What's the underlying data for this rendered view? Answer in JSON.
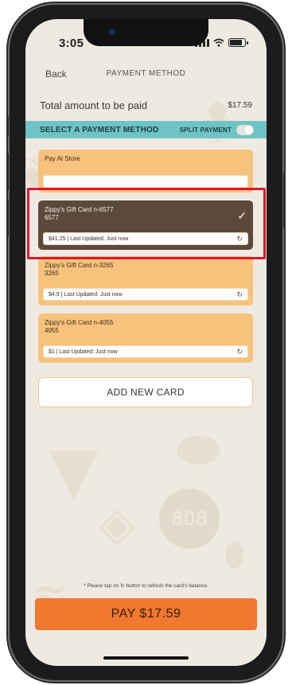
{
  "status_bar": {
    "time": "3:05"
  },
  "navbar": {
    "back_label": "Back",
    "title": "PAYMENT METHOD"
  },
  "total": {
    "label": "Total amount to be paid",
    "value": "$17.59"
  },
  "select_section": {
    "label": "SELECT A PAYMENT METHOD",
    "split_label": "SPLIT PAYMENT",
    "split_enabled": false
  },
  "cards": [
    {
      "title": "Pay At Store",
      "subtitle": "",
      "detail": "",
      "selected": false
    },
    {
      "title": "Zippy's Gift Card n-6577",
      "subtitle": "6577",
      "detail": "$41.25 | Last Updated: Just now",
      "selected": true
    },
    {
      "title": "Zippy's Gift Card n-3265",
      "subtitle": "3265",
      "detail": "$4.9 | Last Updated: Just now",
      "selected": false
    },
    {
      "title": "Zippy's Gift Card n-4055",
      "subtitle": "4055",
      "detail": "$1 | Last Updated: Just now",
      "selected": false
    }
  ],
  "add_card_label": "ADD NEW CARD",
  "note_parts": {
    "before": "* Please tap on",
    "after": "button to refresh the card's balance."
  },
  "pay_button_label": "PAY $17.59",
  "background_text": {
    "number": "808"
  },
  "colors": {
    "accent_orange": "#f0782f",
    "card_orange": "#f7c27c",
    "selected_card": "#5b4a3b",
    "section_teal": "#6ec3c4",
    "highlight_red": "#e0152a"
  }
}
